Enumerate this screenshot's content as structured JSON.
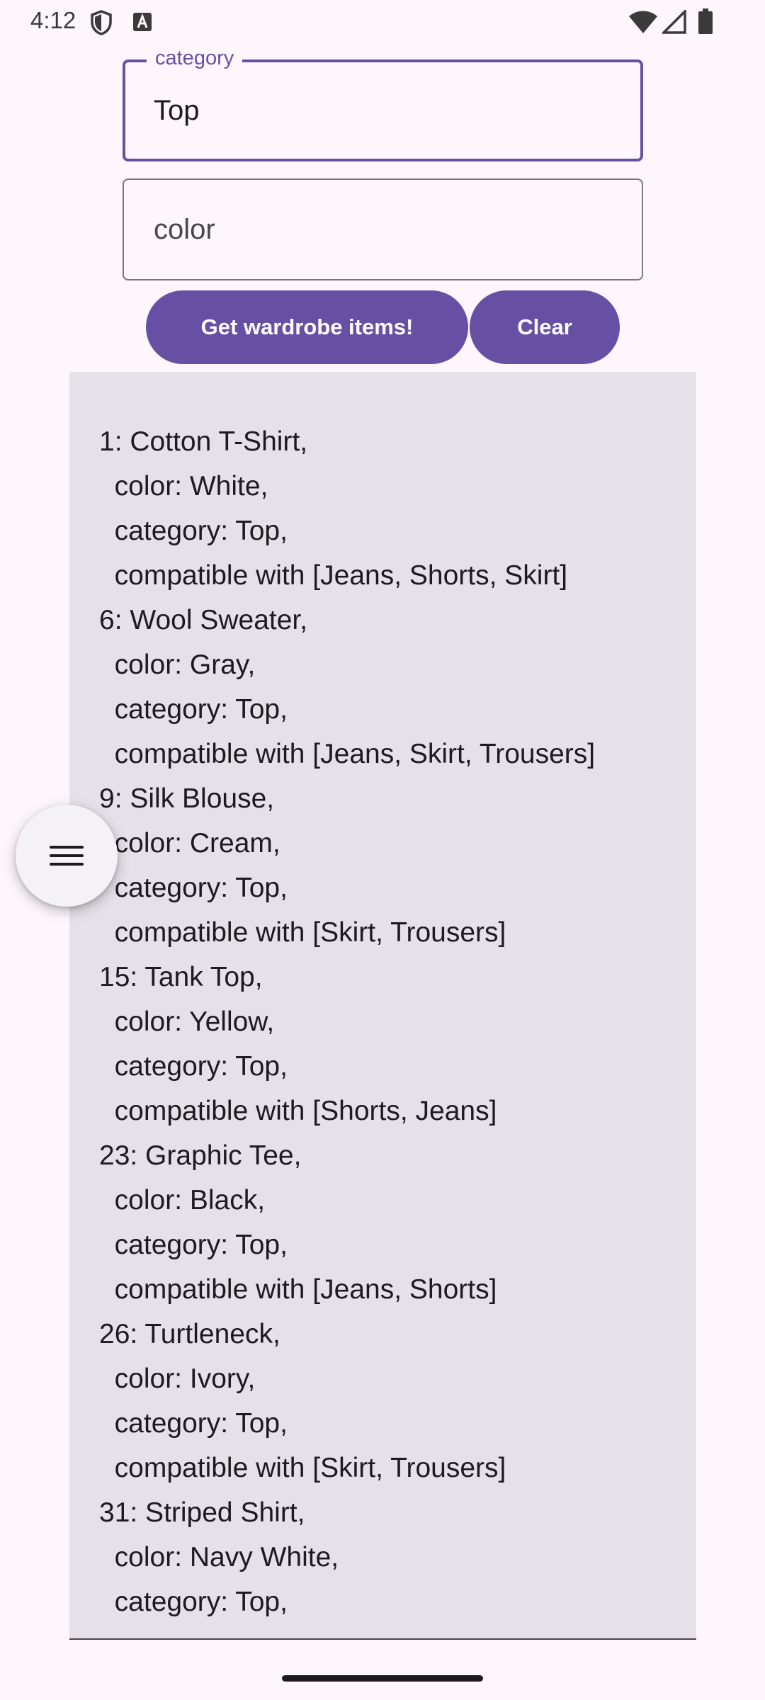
{
  "status_bar": {
    "time": "4:12",
    "icons": [
      "shield-icon",
      "a-notification-icon",
      "wifi-icon",
      "signal-icon",
      "battery-icon"
    ]
  },
  "form": {
    "category_label": "category",
    "category_value": "Top",
    "color_placeholder": "color"
  },
  "buttons": {
    "get_items": "Get wardrobe items!",
    "clear": "Clear"
  },
  "results": {
    "lines": [
      "1: Cotton T-Shirt,",
      "  color: White,",
      "  category: Top,",
      "  compatible with [Jeans, Shorts, Skirt]",
      "6: Wool Sweater,",
      "  color: Gray,",
      "  category: Top,",
      "  compatible with [Jeans, Skirt, Trousers]",
      "9: Silk Blouse,",
      "  color: Cream,",
      "  category: Top,",
      "  compatible with [Skirt, Trousers]",
      "15: Tank Top,",
      "  color: Yellow,",
      "  category: Top,",
      "  compatible with [Shorts, Jeans]",
      "23: Graphic Tee,",
      "  color: Black,",
      "  category: Top,",
      "  compatible with [Jeans, Shorts]",
      "26: Turtleneck,",
      "  color: Ivory,",
      "  category: Top,",
      "  compatible with [Skirt, Trousers]",
      "31: Striped Shirt,",
      "  color: Navy White,",
      "  category: Top,"
    ]
  },
  "fab": {
    "icon": "menu-icon"
  },
  "colors": {
    "primary": "#6750a4",
    "background": "#fdf7fd",
    "panel": "#e6e0e9",
    "outline": "#79747e"
  }
}
